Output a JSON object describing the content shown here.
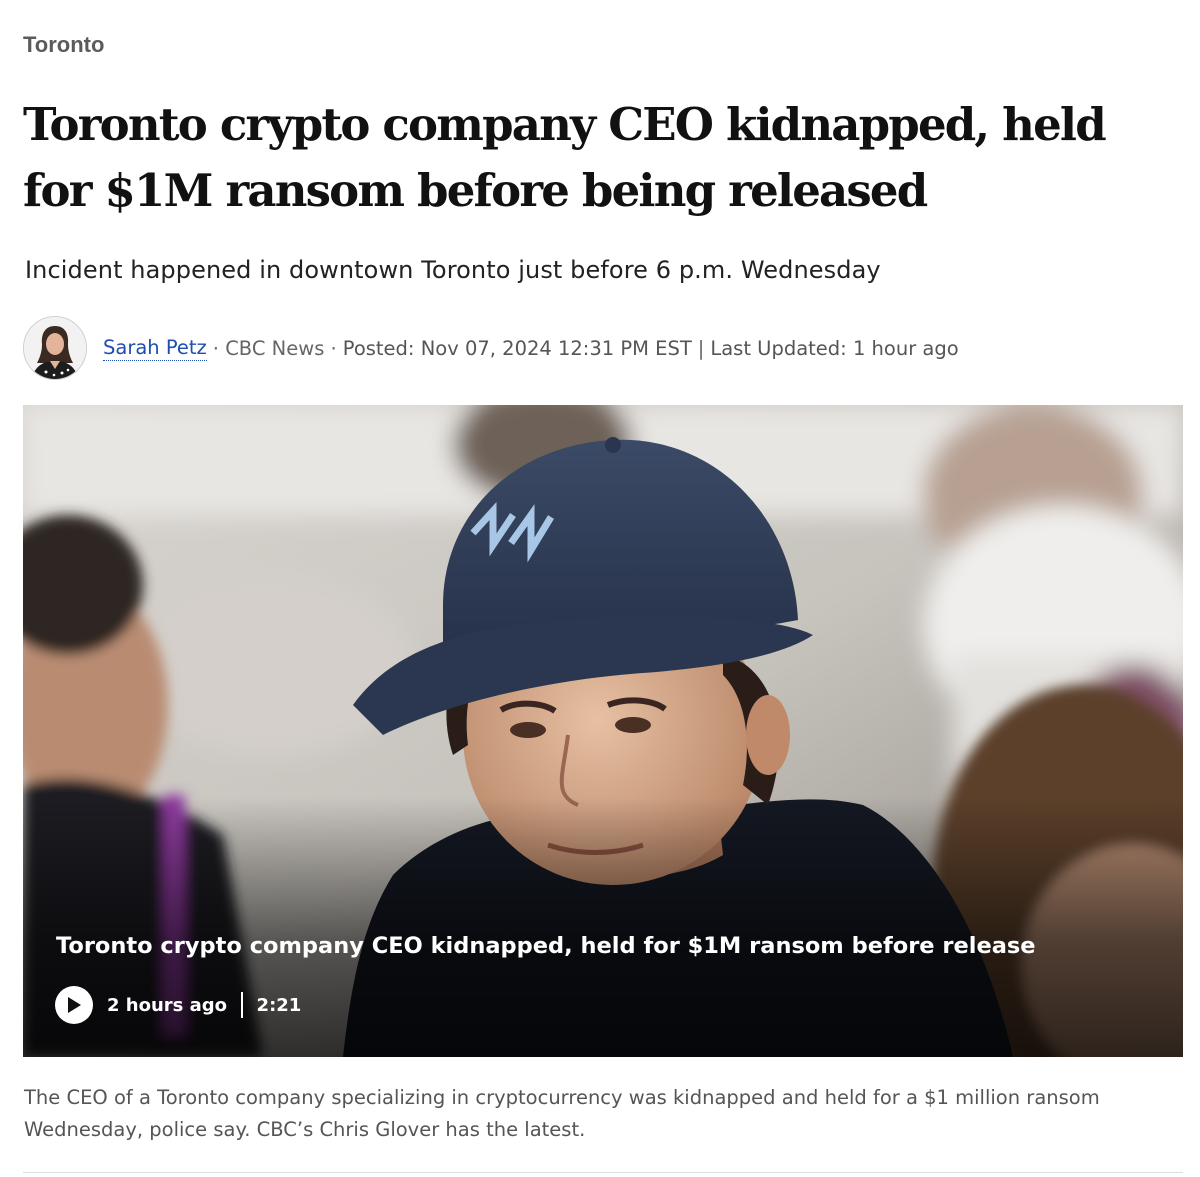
{
  "section": {
    "label": "Toronto"
  },
  "article": {
    "headline": "Toronto crypto company CEO kidnapped, held for $1M ransom before being released",
    "deck": "Incident happened in downtown Toronto just before 6 p.m. Wednesday"
  },
  "byline": {
    "author": "Sarah Petz",
    "outlet": "· CBC News ·",
    "posted": "Posted: Nov 07, 2024 12:31 PM EST",
    "divider": "|",
    "updated": "Last Updated: 1 hour ago"
  },
  "video": {
    "title": "Toronto crypto company CEO kidnapped, held for $1M ransom before release",
    "age": "2 hours ago",
    "duration": "2:21",
    "play_icon": "play-icon"
  },
  "caption": {
    "text": "The CEO of a Toronto company specializing in cryptocurrency was kidnapped and held for a $1 million ransom Wednesday, police say. CBC’s Chris Glover has the latest."
  },
  "colors": {
    "link": "#1f4eb0",
    "headline": "#111111",
    "meta_text": "#555555",
    "overlay_text": "#ffffff"
  }
}
